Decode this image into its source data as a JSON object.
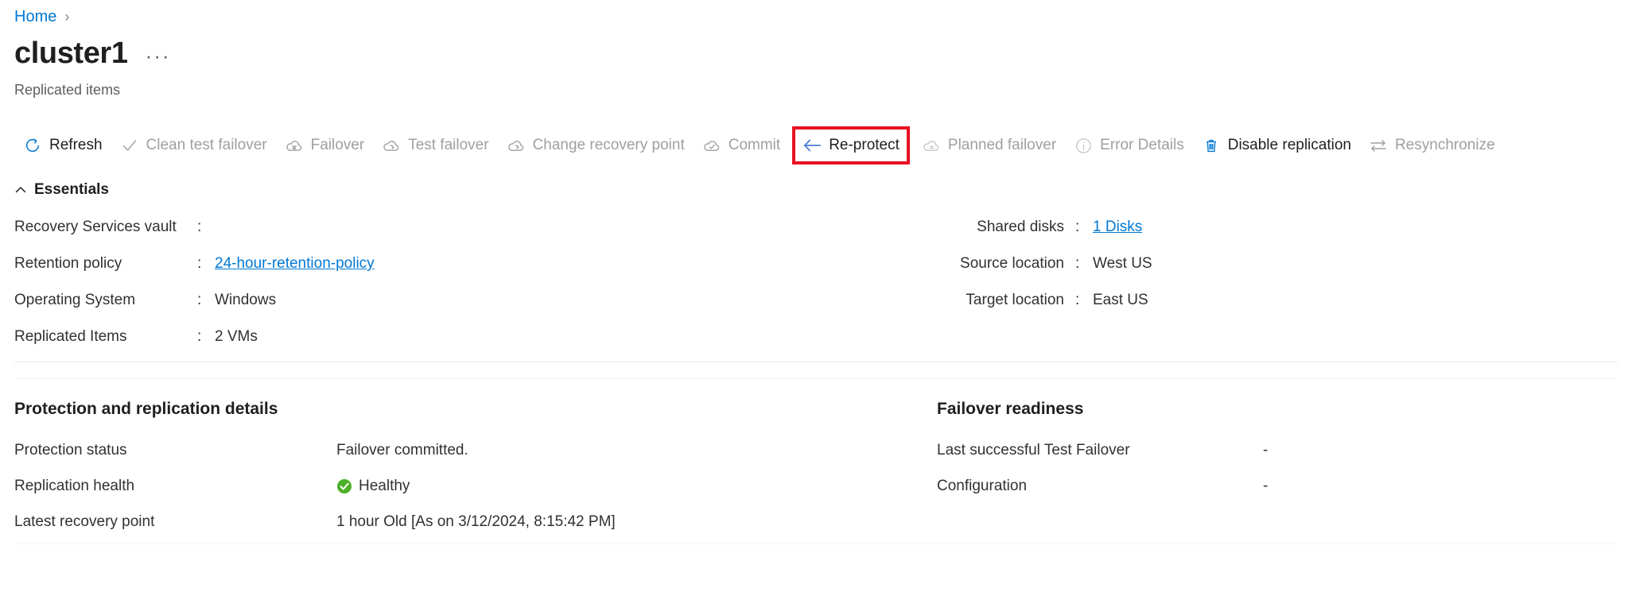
{
  "breadcrumb": {
    "home_label": "Home",
    "separator": "›"
  },
  "header": {
    "title": "cluster1",
    "ellipsis": "···",
    "subtitle": "Replicated items"
  },
  "colors": {
    "accent": "#0078d4",
    "highlight_box": "#e81123",
    "healthy_green": "#4caf28",
    "disabled_text": "#a19f9d",
    "text": "#323130"
  },
  "command_bar": {
    "items": [
      {
        "label": "Refresh",
        "icon": "refresh-icon",
        "disabled": false,
        "highlighted": false
      },
      {
        "label": "Clean test failover",
        "icon": "checkmark-icon",
        "disabled": true,
        "highlighted": false
      },
      {
        "label": "Failover",
        "icon": "cloud-failover-icon",
        "disabled": true,
        "highlighted": false
      },
      {
        "label": "Test failover",
        "icon": "cloud-test-failover-icon",
        "disabled": true,
        "highlighted": false
      },
      {
        "label": "Change recovery point",
        "icon": "cloud-recovery-point-icon",
        "disabled": true,
        "highlighted": false
      },
      {
        "label": "Commit",
        "icon": "cloud-commit-icon",
        "disabled": true,
        "highlighted": false
      },
      {
        "label": "Re-protect",
        "icon": "arrow-left-icon",
        "disabled": false,
        "highlighted": true
      },
      {
        "label": "Planned failover",
        "icon": "cloud-planned-icon",
        "disabled": true,
        "highlighted": false
      },
      {
        "label": "Error Details",
        "icon": "info-circle-icon",
        "disabled": true,
        "highlighted": false
      },
      {
        "label": "Disable replication",
        "icon": "trash-icon",
        "disabled": false,
        "highlighted": false
      },
      {
        "label": "Resynchronize",
        "icon": "resync-arrows-icon",
        "disabled": true,
        "highlighted": false
      }
    ]
  },
  "essentials": {
    "title": "Essentials",
    "collapse_icon": "chevron-up-icon",
    "left_rows": [
      {
        "label": "Recovery Services vault",
        "colon": ":",
        "value": "",
        "link": false
      },
      {
        "label": "Retention policy",
        "colon": ":",
        "value": "24-hour-retention-policy",
        "link": true
      },
      {
        "label": "Operating System",
        "colon": ":",
        "value": "Windows",
        "link": false
      },
      {
        "label": "Replicated Items",
        "colon": ":",
        "value": "2 VMs",
        "link": false
      }
    ],
    "right_rows": [
      {
        "label": "Shared disks",
        "colon": ":",
        "value": "1 Disks",
        "link": true
      },
      {
        "label": "Source location",
        "colon": ":",
        "value": "West US",
        "link": false
      },
      {
        "label": "Target location",
        "colon": ":",
        "value": "East US",
        "link": false
      }
    ]
  },
  "protection_details": {
    "heading": "Protection and replication details",
    "rows": [
      {
        "label": "Protection status",
        "value": "Failover committed.",
        "icon": ""
      },
      {
        "label": "Replication health",
        "value": "Healthy",
        "icon": "healthy-check-icon"
      },
      {
        "label": "Latest recovery point",
        "value": "1 hour Old [As on 3/12/2024, 8:15:42 PM]",
        "icon": ""
      }
    ]
  },
  "failover_readiness": {
    "heading": "Failover readiness",
    "rows": [
      {
        "label": "Last successful Test Failover",
        "value": "-"
      },
      {
        "label": "Configuration",
        "value": "-"
      }
    ]
  }
}
